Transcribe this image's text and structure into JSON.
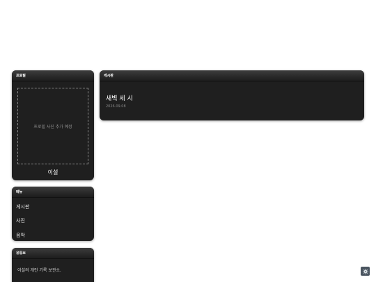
{
  "profile": {
    "header": "프로필",
    "photo_placeholder": "프로필 사진 추가 예정",
    "name": "이설"
  },
  "menu": {
    "header": "메뉴",
    "items": [
      {
        "label": "게시판"
      },
      {
        "label": "사진"
      },
      {
        "label": "음악"
      }
    ]
  },
  "youtube": {
    "header": "유튜브",
    "text": "이설의 개인 기록 보관소."
  },
  "board": {
    "header": "게시판",
    "post": {
      "title": "새벽 세 시",
      "date": "2026.09.08"
    }
  },
  "floating_button": {
    "icon": "gear-icon"
  },
  "colors": {
    "panel_bg": "#1f1f1f",
    "header_top": "#3c3c3c",
    "page_bg": "#ffffff",
    "float_button": "#4a5560"
  }
}
